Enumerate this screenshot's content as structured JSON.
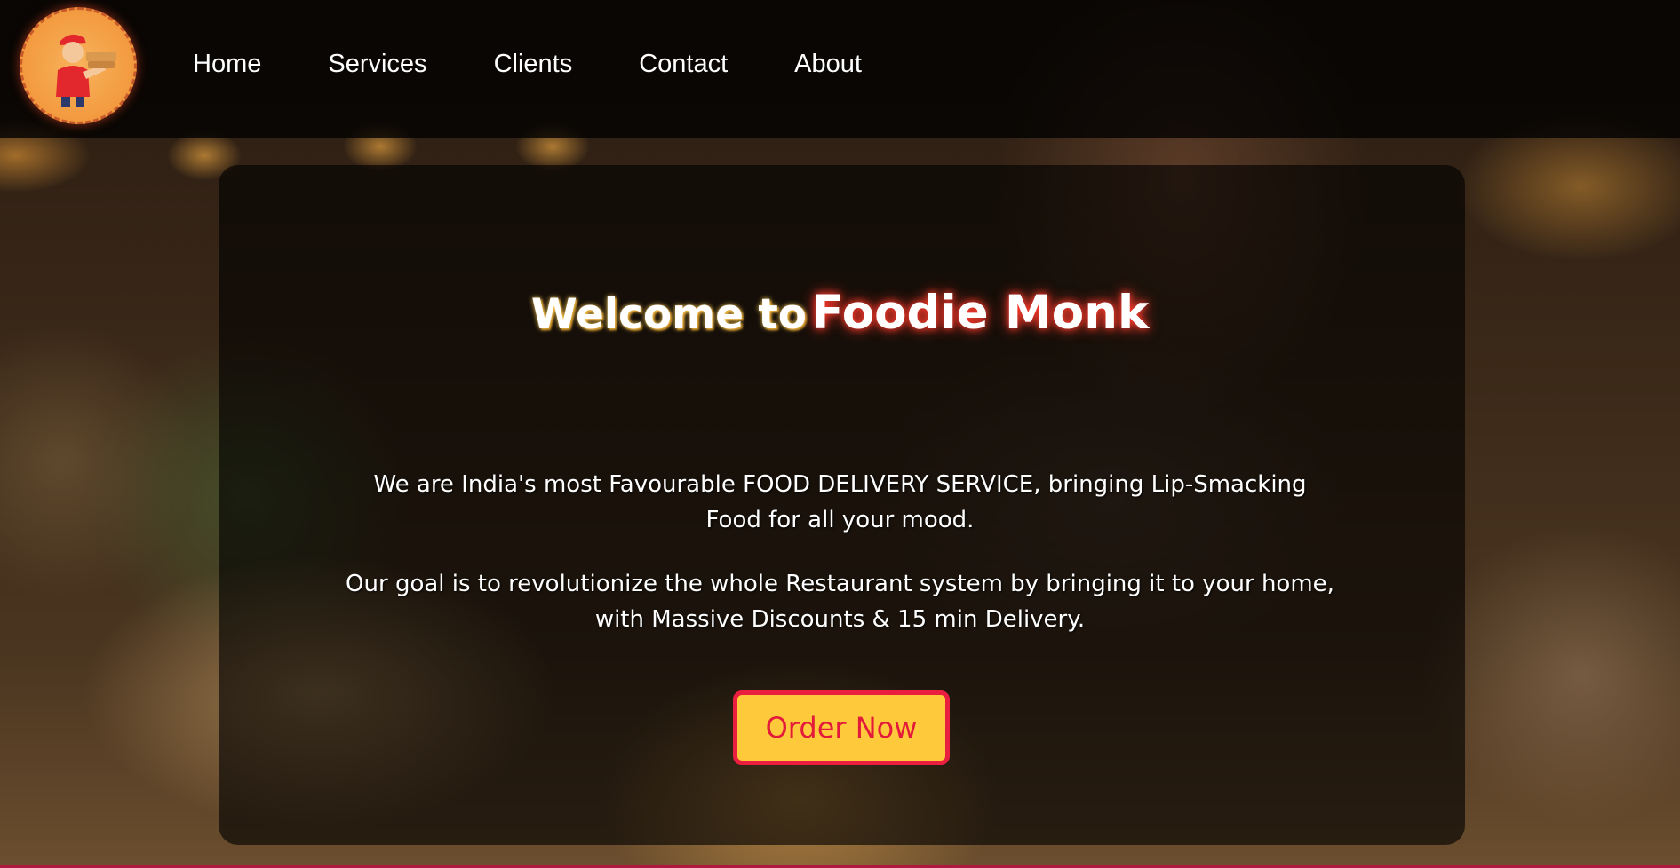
{
  "nav": {
    "links": [
      "Home",
      "Services",
      "Clients",
      "Contact",
      "About"
    ]
  },
  "hero": {
    "title_prefix": "Welcome to",
    "title_brand": "Foodie Monk",
    "paragraph1_line1": "We are India's most Favourable FOOD DELIVERY SERVICE, bringing Lip-Smacking",
    "paragraph1_line2": "Food for all your mood.",
    "paragraph2_line1": "Our goal is to revolutionize the whole Restaurant system by bringing it to your home,",
    "paragraph2_line2": "with Massive Discounts & 15 min Delivery.",
    "cta_label": "Order Now"
  },
  "colors": {
    "accent_yellow": "#ffc93c",
    "accent_red": "#ea1f3f",
    "logo_orange": "#f39a3f"
  },
  "icons": {
    "logo": "delivery-man-logo-icon"
  }
}
